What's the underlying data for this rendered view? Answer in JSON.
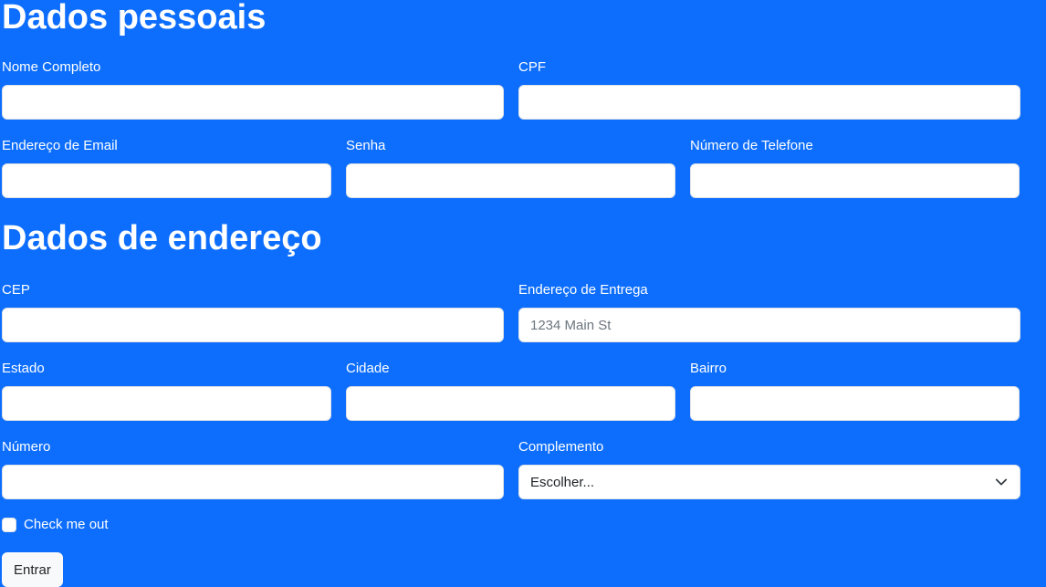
{
  "personal": {
    "title": "Dados pessoais",
    "nome_label": "Nome Completo",
    "cpf_label": "CPF",
    "email_label": "Endereço de Email",
    "senha_label": "Senha",
    "telefone_label": "Número de Telefone"
  },
  "address": {
    "title": "Dados de endereço",
    "cep_label": "CEP",
    "entrega_label": "Endereço de Entrega",
    "entrega_placeholder": "1234 Main St",
    "estado_label": "Estado",
    "cidade_label": "Cidade",
    "bairro_label": "Bairro",
    "numero_label": "Número",
    "complemento_label": "Complemento",
    "complemento_selected": "Escolher..."
  },
  "check": {
    "label": "Check me out"
  },
  "submit": {
    "label": "Entrar"
  },
  "colors": {
    "background": "#0d6efd",
    "input_bg": "#ffffff",
    "button_bg": "#f8f9fa"
  }
}
